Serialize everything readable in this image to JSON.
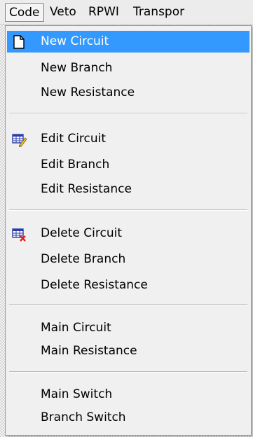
{
  "menubar": {
    "items": [
      {
        "label": "Code"
      },
      {
        "label": "Veto"
      },
      {
        "label": "RPWI"
      },
      {
        "label": "Transpor"
      }
    ]
  },
  "dropdown": {
    "highlight_color": "#3399ff",
    "groups": [
      {
        "items": [
          {
            "label": "New Circuit",
            "icon": "new-document-icon",
            "highlighted": true
          },
          {
            "label": "New Branch"
          },
          {
            "label": "New Resistance"
          }
        ]
      },
      {
        "items": [
          {
            "label": "Edit Circuit",
            "icon": "edit-table-icon"
          },
          {
            "label": "Edit Branch"
          },
          {
            "label": "Edit Resistance"
          }
        ]
      },
      {
        "items": [
          {
            "label": "Delete Circuit",
            "icon": "delete-table-icon"
          },
          {
            "label": "Delete Branch"
          },
          {
            "label": "Delete Resistance"
          }
        ]
      },
      {
        "items": [
          {
            "label": "Main Circuit"
          },
          {
            "label": "Main Resistance"
          }
        ]
      },
      {
        "items": [
          {
            "label": "Main Switch"
          },
          {
            "label": "Branch Switch"
          }
        ]
      }
    ]
  }
}
